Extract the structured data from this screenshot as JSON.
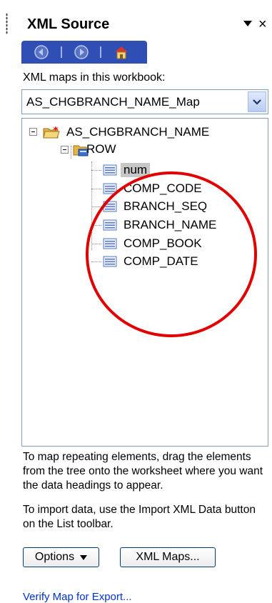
{
  "pane": {
    "title": "XML Source",
    "close_glyph": "×"
  },
  "toolbar": {
    "buttons": [
      {
        "name": "back",
        "icon": "left-arrow-icon"
      },
      {
        "name": "forward",
        "icon": "right-arrow-icon"
      },
      {
        "name": "home",
        "icon": "home-icon"
      }
    ]
  },
  "maps": {
    "label": "XML maps in this workbook:",
    "selected": "AS_CHGBRANCH_NAME_Map"
  },
  "tree": {
    "root": "AS_CHGBRANCH_NAME",
    "row": "ROW",
    "fields": [
      "num",
      "COMP_CODE",
      "BRANCH_SEQ",
      "BRANCH_NAME",
      "COMP_BOOK",
      "COMP_DATE"
    ],
    "selected_field": "num"
  },
  "help": {
    "paragraph1": "To map repeating elements, drag the elements from the tree onto the worksheet where you want the data headings to appear.",
    "paragraph2": "To import data, use the Import XML Data button on the List toolbar."
  },
  "buttons": {
    "options": "Options",
    "xml_maps": "XML Maps..."
  },
  "footer": {
    "verify_link": "Verify Map for Export..."
  },
  "colors": {
    "toolbar": "#2f4fb5",
    "annotation_circle": "#e00000",
    "link": "#0033cc"
  }
}
